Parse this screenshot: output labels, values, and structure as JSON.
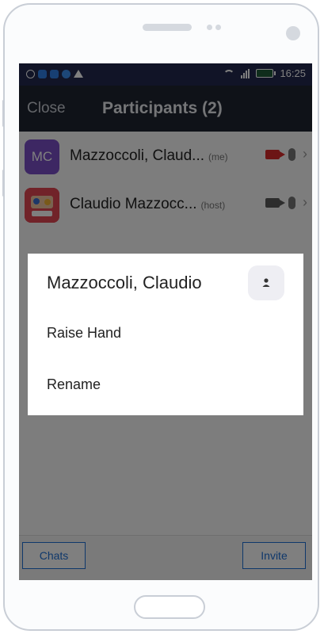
{
  "status_bar": {
    "time": "16:25",
    "left_icons": [
      {
        "name": "whatsapp-icon",
        "color": "#ffffff"
      },
      {
        "name": "app-icon-blue",
        "color": "#2f7fe6"
      },
      {
        "name": "app-icon-blue-2",
        "color": "#2f7fe6"
      },
      {
        "name": "messenger-icon",
        "color": "#3b8ff0"
      },
      {
        "name": "warning-icon",
        "color": "#ffffff"
      }
    ]
  },
  "nav": {
    "close_label": "Close",
    "title": "Participants (2)"
  },
  "participants": [
    {
      "initials": "MC",
      "name": "Mazzoccoli, Claud...",
      "tag": "(me)",
      "video_muted": true
    },
    {
      "initials": "",
      "name": "Claudio Mazzocc...",
      "tag": "(host)",
      "video_muted": false
    }
  ],
  "bottom": {
    "chats_label": "Chats",
    "invite_label": "Invite"
  },
  "dialog": {
    "title": "Mazzoccoli, Claudio",
    "items": [
      "Raise Hand",
      "Rename"
    ]
  },
  "colors": {
    "status_bar": "#22294f",
    "nav_bar": "#1f2430",
    "accent": "#1f70d6",
    "avatar_mc": "#7b4fc6",
    "video_off": "#d92b2b"
  }
}
